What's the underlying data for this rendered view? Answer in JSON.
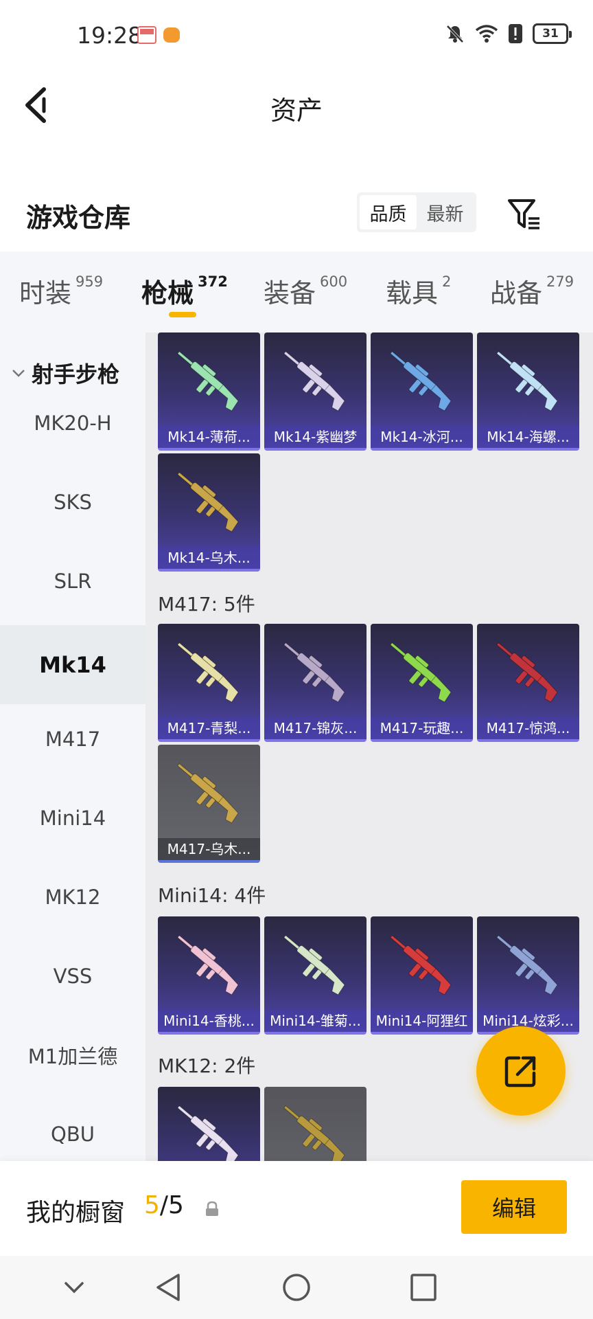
{
  "status_bar": {
    "time": "19:28",
    "battery": "31",
    "icons": [
      "notification-app-icon",
      "notification-app2-icon",
      "mute-icon",
      "wifi-icon",
      "alert-icon",
      "battery-icon"
    ]
  },
  "nav": {
    "title": "资产",
    "back_icon": "back-chevron-icon"
  },
  "header": {
    "title": "游戏仓库",
    "sort_options": [
      {
        "label": "品质",
        "active": true
      },
      {
        "label": "最新",
        "active": false
      }
    ],
    "filter_icon": "filter-icon"
  },
  "tabs": [
    {
      "label": "时装",
      "count": "959",
      "active": false
    },
    {
      "label": "枪械",
      "count": "372",
      "active": true
    },
    {
      "label": "装备",
      "count": "600",
      "active": false
    },
    {
      "label": "载具",
      "count": "2",
      "active": false
    },
    {
      "label": "战备",
      "count": "279",
      "active": false
    }
  ],
  "sidebar": {
    "group": "射手步枪",
    "items": [
      {
        "label": "MK20-H",
        "active": false
      },
      {
        "label": "SKS",
        "active": false
      },
      {
        "label": "SLR",
        "active": false
      },
      {
        "label": "Mk14",
        "active": true
      },
      {
        "label": "M417",
        "active": false
      },
      {
        "label": "Mini14",
        "active": false
      },
      {
        "label": "MK12",
        "active": false
      },
      {
        "label": "VSS",
        "active": false
      },
      {
        "label": "M1加兰德",
        "active": false
      },
      {
        "label": "QBU",
        "active": false
      }
    ]
  },
  "groups": [
    {
      "label": "",
      "items": [
        {
          "name": "Mk14-薄荷...",
          "style": "purple",
          "color": "#9be3b0"
        },
        {
          "name": "Mk14-紫幽梦",
          "style": "purple",
          "color": "#d9d2ea"
        },
        {
          "name": "Mk14-冰河...",
          "style": "purple",
          "color": "#6fa8e6"
        },
        {
          "name": "Mk14-海螺...",
          "style": "purple",
          "color": "#bfe0f5"
        },
        {
          "name": "Mk14-乌木...",
          "style": "purple",
          "color": "#c9a64a"
        }
      ]
    },
    {
      "label": "M417: 5件",
      "items": [
        {
          "name": "M417-青梨...",
          "style": "purple",
          "color": "#e6e0a8"
        },
        {
          "name": "M417-锦灰...",
          "style": "purple",
          "color": "#b8a9c9"
        },
        {
          "name": "M417-玩趣...",
          "style": "purple",
          "color": "#8fd94c"
        },
        {
          "name": "M417-惊鸿...",
          "style": "purple",
          "color": "#c2343c"
        },
        {
          "name": "M417-乌木...",
          "style": "grey",
          "color": "#c9a64a"
        }
      ]
    },
    {
      "label": "Mini14: 4件",
      "items": [
        {
          "name": "Mini14-香桃...",
          "style": "purple",
          "color": "#f0c2d4"
        },
        {
          "name": "Mini14-雏菊...",
          "style": "purple",
          "color": "#d6e6c8"
        },
        {
          "name": "Mini14-阿狸红",
          "style": "purple",
          "color": "#d63c3c"
        },
        {
          "name": "Mini14-炫彩...",
          "style": "purple",
          "color": "#8fa3d6"
        }
      ]
    },
    {
      "label": "MK12: 2件",
      "items": [
        {
          "name": "",
          "style": "purple",
          "color": "#e8e0f0"
        },
        {
          "name": "",
          "style": "grey",
          "color": "#b89a3e"
        }
      ]
    }
  ],
  "fab": {
    "icon": "share-export-icon"
  },
  "showcase": {
    "label": "我的橱窗",
    "current": "5",
    "separator": "/",
    "total": "5",
    "lock_icon": "lock-icon",
    "edit_label": "编辑"
  },
  "system_nav": {
    "icons": [
      "collapse-chevron-icon",
      "back-triangle-icon",
      "home-circle-icon",
      "recents-square-icon"
    ]
  },
  "colors": {
    "accent": "#f9b400",
    "card_purple": "#4e45a8",
    "card_grey": "#5f5f66"
  }
}
